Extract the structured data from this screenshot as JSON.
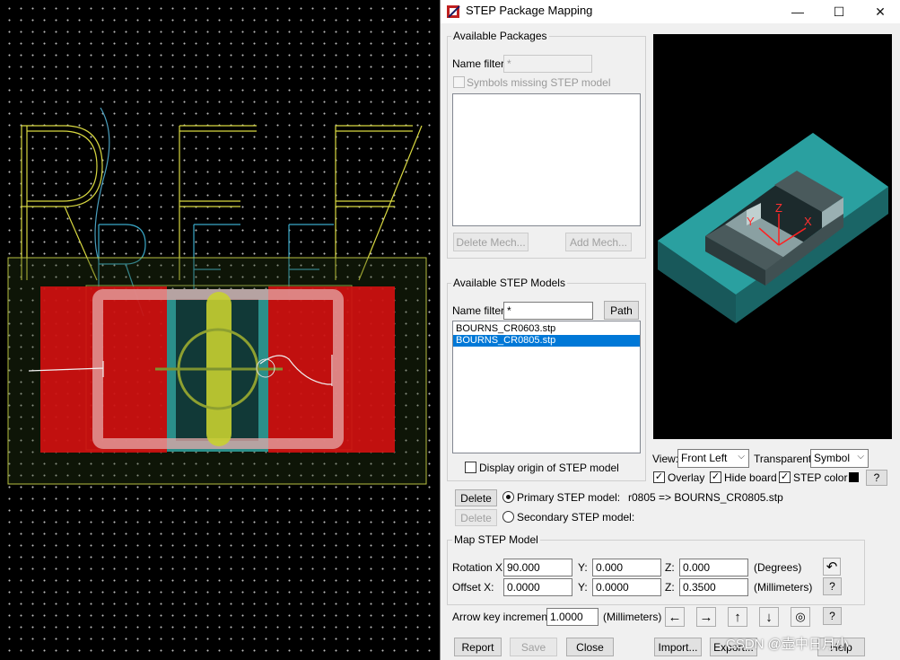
{
  "window": {
    "title": "STEP Package Mapping",
    "minimize_glyph": "—",
    "maximize_glyph": "☐",
    "close_glyph": "✕"
  },
  "available_packages": {
    "legend": "Available Packages",
    "name_filter_label": "Name filter:",
    "name_filter_value": "*",
    "symbols_missing_label": "Symbols missing STEP model",
    "delete_mech": "Delete Mech...",
    "add_mech": "Add Mech..."
  },
  "available_step_models": {
    "legend": "Available STEP Models",
    "name_filter_label": "Name filter:",
    "name_filter_value": "*",
    "path_button": "Path",
    "models": [
      "BOURNS_CR0603.stp",
      "BOURNS_CR0805.stp"
    ],
    "selected_index": 1,
    "display_origin_label": "Display origin of STEP model"
  },
  "preview": {
    "axis_x": "X",
    "axis_y": "Y",
    "axis_z": "Z",
    "view_label": "View:",
    "view_value": "Front Left",
    "transparent_label": "Transparent:",
    "transparent_value": "Symbol",
    "overlay_label": "Overlay",
    "hide_board_label": "Hide board",
    "step_color_label": "STEP color",
    "help_q": "?",
    "step_color": "#000000"
  },
  "models": {
    "delete_primary": "Delete",
    "primary_label": "Primary STEP model:",
    "primary_value": "r0805 => BOURNS_CR0805.stp",
    "delete_secondary": "Delete",
    "secondary_label": "Secondary STEP model:"
  },
  "map_step_model": {
    "legend": "Map STEP Model",
    "rotation_label": "Rotation X:",
    "rot_x": "90.000",
    "y_label": "Y:",
    "rot_y": "0.000",
    "z_label": "Z:",
    "rot_z": "0.000",
    "degrees": "(Degrees)",
    "offset_label": "Offset X:",
    "off_x": "0.0000",
    "off_y": "0.0000",
    "off_z": "0.3500",
    "millimeters": "(Millimeters)",
    "q": "?"
  },
  "arrow_key": {
    "label": "Arrow key increment:",
    "value": "1.0000",
    "unit": "(Millimeters)",
    "q": "?"
  },
  "bottom_buttons": {
    "report": "Report",
    "save": "Save",
    "close": "Close",
    "import": "Import...",
    "export": "Export...",
    "help": "Help"
  },
  "watermark": "CSDN @壶中日月小",
  "colors": {
    "pad_red": "#d01010",
    "teal": "#2e9e9a",
    "selection_blue": "#0078d7",
    "silk_yellow": "#e8e840",
    "ref_cyan": "#3ab0d0"
  }
}
